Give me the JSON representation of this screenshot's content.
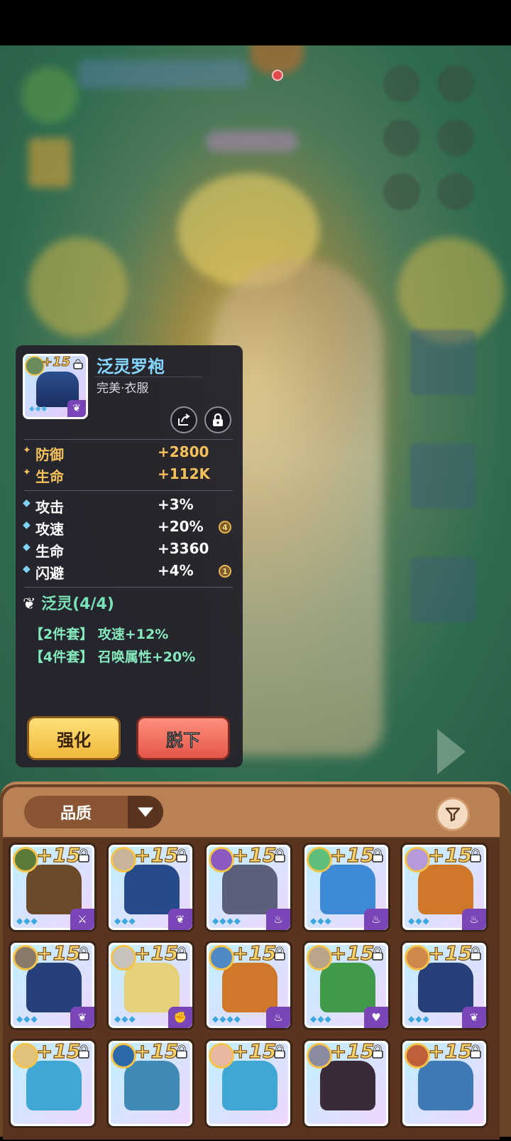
{
  "item": {
    "plus_level": "+15",
    "name": "泛灵罗袍",
    "subtitle": "完美·衣服",
    "diamonds": "◆◆◆",
    "main_stats": [
      {
        "name": "防御",
        "value": "+2800"
      },
      {
        "name": "生命",
        "value": "+112K"
      }
    ],
    "sub_stats": [
      {
        "name": "攻击",
        "value": "+3%",
        "badge": ""
      },
      {
        "name": "攻速",
        "value": "+20%",
        "badge": "4"
      },
      {
        "name": "生命",
        "value": "+3360",
        "badge": ""
      },
      {
        "name": "闪避",
        "value": "+4%",
        "badge": "1"
      }
    ],
    "set": {
      "title": "泛灵(4/4)",
      "bonuses": [
        "【2件套】 攻速+12%",
        "【4件套】 召唤属性+20%"
      ]
    }
  },
  "buttons": {
    "enhance": "强化",
    "unequip": "脱下"
  },
  "inventory": {
    "sort_label": "品质",
    "slots": [
      {
        "plus": "+15",
        "diamonds": "◆◆◆",
        "badge_color": "#7a45b7",
        "badge_icon": "sword",
        "art": "#6b4a2a",
        "avatar": "#5c7a3a"
      },
      {
        "plus": "+15",
        "diamonds": "◆◆◆",
        "badge_color": "#7a45b7",
        "badge_icon": "spirit",
        "art": "#274a8a",
        "avatar": "#c9b49a"
      },
      {
        "plus": "+15",
        "diamonds": "◆◆◆◆",
        "badge_color": "#7a45b7",
        "badge_icon": "flame",
        "art": "#5a5f7c",
        "avatar": "#8a5ac0"
      },
      {
        "plus": "+15",
        "diamonds": "◆◆◆",
        "badge_color": "#7a45b7",
        "badge_icon": "flame",
        "art": "#3f8ad6",
        "avatar": "#5fbf7a"
      },
      {
        "plus": "+15",
        "diamonds": "◆◆◆",
        "badge_color": "#7a45b7",
        "badge_icon": "flame",
        "art": "#d0782a",
        "avatar": "#b59ad9"
      },
      {
        "plus": "+15",
        "diamonds": "◆◆◆",
        "badge_color": "#7a45b7",
        "badge_icon": "spirit",
        "art": "#27407a",
        "avatar": "#8a7a6a"
      },
      {
        "plus": "+15",
        "diamonds": "◆◆◆",
        "badge_color": "#7a45b7",
        "badge_icon": "fist",
        "art": "#e6d07a",
        "avatar": "#c9c3bd"
      },
      {
        "plus": "+15",
        "diamonds": "◆◆◆◆",
        "badge_color": "#7a45b7",
        "badge_icon": "flame",
        "art": "#d0782a",
        "avatar": "#4f8ac6"
      },
      {
        "plus": "+15",
        "diamonds": "◆◆◆",
        "badge_color": "#7a45b7",
        "badge_icon": "heart",
        "art": "#3f9a4a",
        "avatar": "#b8a48a"
      },
      {
        "plus": "+15",
        "diamonds": "◆◆◆",
        "badge_color": "#7a45b7",
        "badge_icon": "spirit",
        "art": "#27407a",
        "avatar": "#d0884a"
      },
      {
        "plus": "+15",
        "diamonds": "",
        "badge_color": "#7a45b7",
        "badge_icon": "",
        "art": "#3fa7d6",
        "avatar": "#e0c27a"
      },
      {
        "plus": "+15",
        "diamonds": "",
        "badge_color": "#7a45b7",
        "badge_icon": "",
        "art": "#3f8ab6",
        "avatar": "#2a6aa8"
      },
      {
        "plus": "+15",
        "diamonds": "",
        "badge_color": "#7a45b7",
        "badge_icon": "",
        "art": "#3fa7d6",
        "avatar": "#e8b8a0"
      },
      {
        "plus": "+15",
        "diamonds": "",
        "badge_color": "#7a45b7",
        "badge_icon": "",
        "art": "#3a2a3a",
        "avatar": "#8a8aa0"
      },
      {
        "plus": "+15",
        "diamonds": "",
        "badge_color": "#7a45b7",
        "badge_icon": "",
        "art": "#3f7ab6",
        "avatar": "#c0603a"
      }
    ]
  }
}
